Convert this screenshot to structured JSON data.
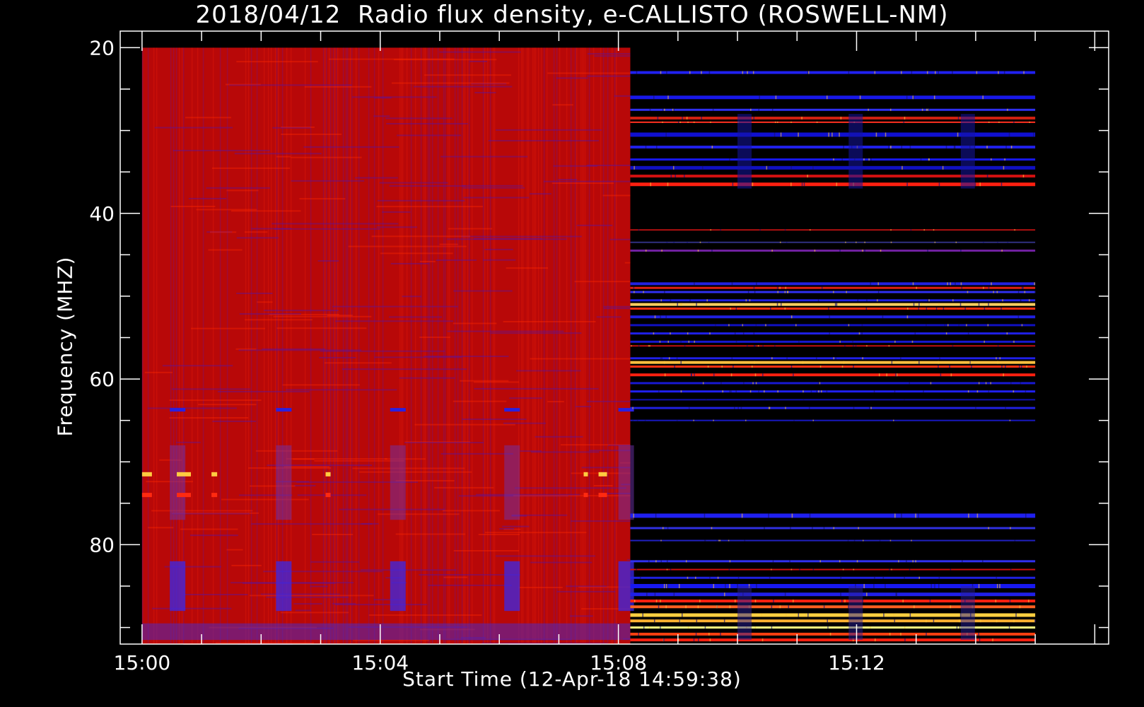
{
  "chart_data": {
    "type": "heatmap",
    "title": "2018/04/12  Radio flux density, e-CALLISTO (ROSWELL-NM)",
    "xlabel": "Start Time (12-Apr-18 14:59:38)",
    "ylabel": "Frequency (MHZ)",
    "xlim": [
      "14:59:38",
      "15:16:14"
    ],
    "ylim": [
      92,
      18
    ],
    "data_range": {
      "start": "15:00:00",
      "end": "15:15:00",
      "freq_min": 20,
      "freq_max": 92
    },
    "x_ticks": [
      "15:00",
      "15:04",
      "15:08",
      "15:12"
    ],
    "x_minor_tick_step_minutes": 1,
    "y_ticks": [
      20,
      40,
      60,
      80
    ],
    "y_minor_tick_step_mhz": 5,
    "colormap": "blue-red-yellow",
    "colors": {
      "background": "#000000",
      "low": "#1010e8",
      "mid": "#c80000",
      "high": "#ffe040"
    },
    "segments": [
      {
        "name": "dense",
        "start": "15:00:00",
        "end": "15:08:12",
        "dominant": "red"
      },
      {
        "name": "sparse",
        "start": "15:08:12",
        "end": "15:15:00",
        "dominant": "black"
      }
    ],
    "vertical_bands_dense": {
      "times": [
        "15:00:28",
        "15:02:15",
        "15:04:10",
        "15:06:05",
        "15:08:00"
      ],
      "freq_range": [
        82,
        88
      ]
    },
    "bright_lines": [
      {
        "freq": 71.5,
        "intensity": "yellow"
      },
      {
        "freq": 74.0,
        "intensity": "red"
      },
      {
        "freq": 51.0,
        "intensity": "yellow"
      },
      {
        "freq": 58.0,
        "intensity": "yellow"
      },
      {
        "freq": 88.5,
        "intensity": "yellow"
      },
      {
        "freq": 90.0,
        "intensity": "yellow"
      }
    ]
  }
}
